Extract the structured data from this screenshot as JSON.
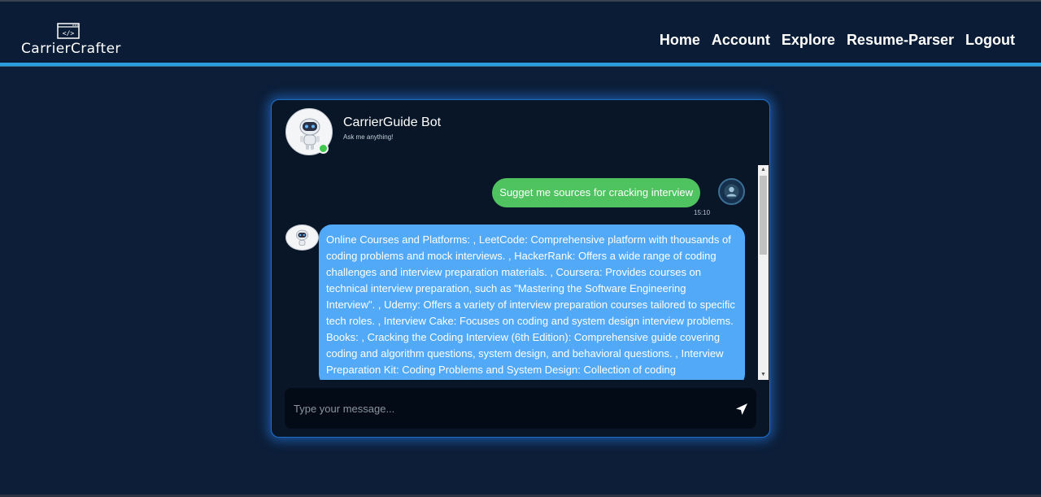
{
  "brand": {
    "name": "CarrierCrafter",
    "icon": "code-window-icon",
    "icon_glyph": "</>"
  },
  "nav": {
    "items": [
      {
        "label": "Home"
      },
      {
        "label": "Account"
      },
      {
        "label": "Explore"
      },
      {
        "label": "Resume-Parser"
      },
      {
        "label": "Logout"
      }
    ]
  },
  "chat": {
    "bot_name": "CarrierGuide Bot",
    "bot_subtitle": "Ask me anything!",
    "status": "online",
    "messages": [
      {
        "sender": "user",
        "text": "Sugget me sources for cracking interview",
        "time": "15:10"
      },
      {
        "sender": "bot",
        "text": "Online Courses and Platforms: , LeetCode: Comprehensive platform with thousands of coding problems and mock interviews. , HackerRank: Offers a wide range of coding challenges and interview preparation materials. , Coursera: Provides courses on technical interview preparation, such as \"Mastering the Software Engineering Interview\". , Udemy: Offers a variety of interview preparation courses tailored to specific tech roles. , Interview Cake: Focuses on coding and system design interview problems. Books: , Cracking the Coding Interview (6th Edition): Comprehensive guide covering coding and algorithm questions, system design, and behavioral questions. , Interview Preparation Kit: Coding Problems and System Design: Collection of coding"
      }
    ],
    "input": {
      "placeholder": "Type your message...",
      "value": ""
    }
  },
  "colors": {
    "page_background": "#0c1e38",
    "header_accent": "#2a9fe0",
    "user_bubble": "#4fc35f",
    "bot_bubble": "#51a9f7",
    "online": "#3ec94d"
  }
}
